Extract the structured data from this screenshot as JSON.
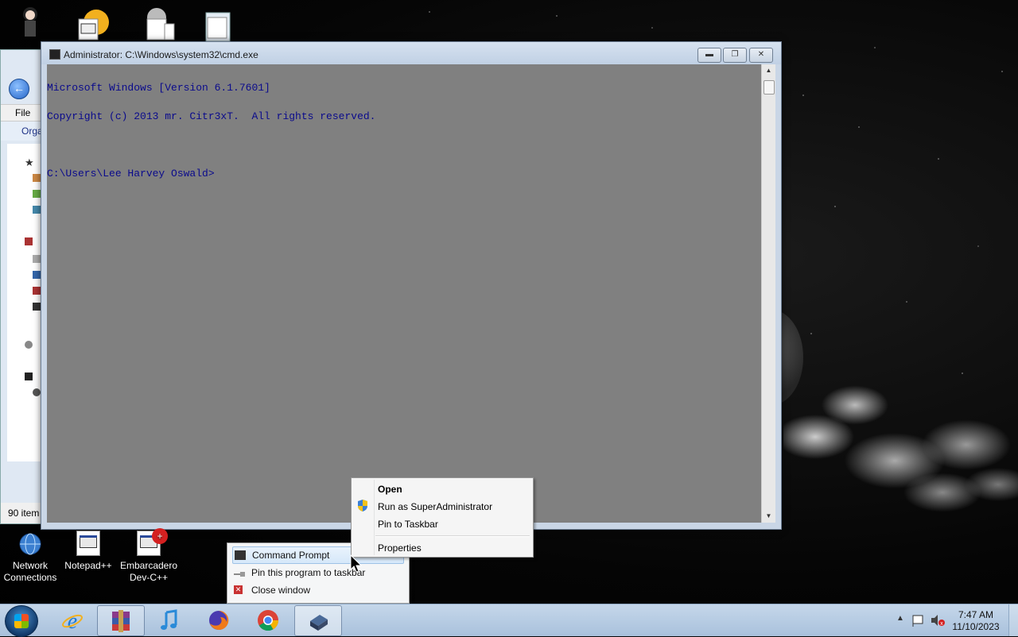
{
  "desktop": {
    "icons": [
      {
        "name": "network-connections",
        "label": "Network\nConnections"
      },
      {
        "name": "notepad-plus-plus",
        "label": "Notepad++"
      },
      {
        "name": "embarcadero-dev-cpp",
        "label": "Embarcadero\nDev-C++"
      }
    ]
  },
  "explorer": {
    "menu_file": "File",
    "organize": "Orga",
    "status": "90 item"
  },
  "cmd": {
    "title": "Administrator: C:\\Windows\\system32\\cmd.exe",
    "lines": [
      "Microsoft Windows [Version 6.1.7601]",
      "Copyright (c) 2013 mr. Citr3xT.  All rights reserved.",
      "",
      "C:\\Users\\Lee Harvey Oswald>"
    ],
    "console_bg": "#808080",
    "console_fg": "#0a0a8c"
  },
  "jumplist": {
    "title_item": "Command Prompt",
    "pin": "Pin this program to taskbar",
    "close": "Close window"
  },
  "context_menu": {
    "open": "Open",
    "run_as": "Run as SuperAdministrator",
    "pin_taskbar": "Pin to Taskbar",
    "properties": "Properties"
  },
  "taskbar": {
    "items": [
      "start",
      "internet-explorer",
      "winrar",
      "itunes",
      "firefox",
      "chrome",
      "command-prompt"
    ],
    "time": "7:47 AM",
    "date": "11/10/2023"
  }
}
